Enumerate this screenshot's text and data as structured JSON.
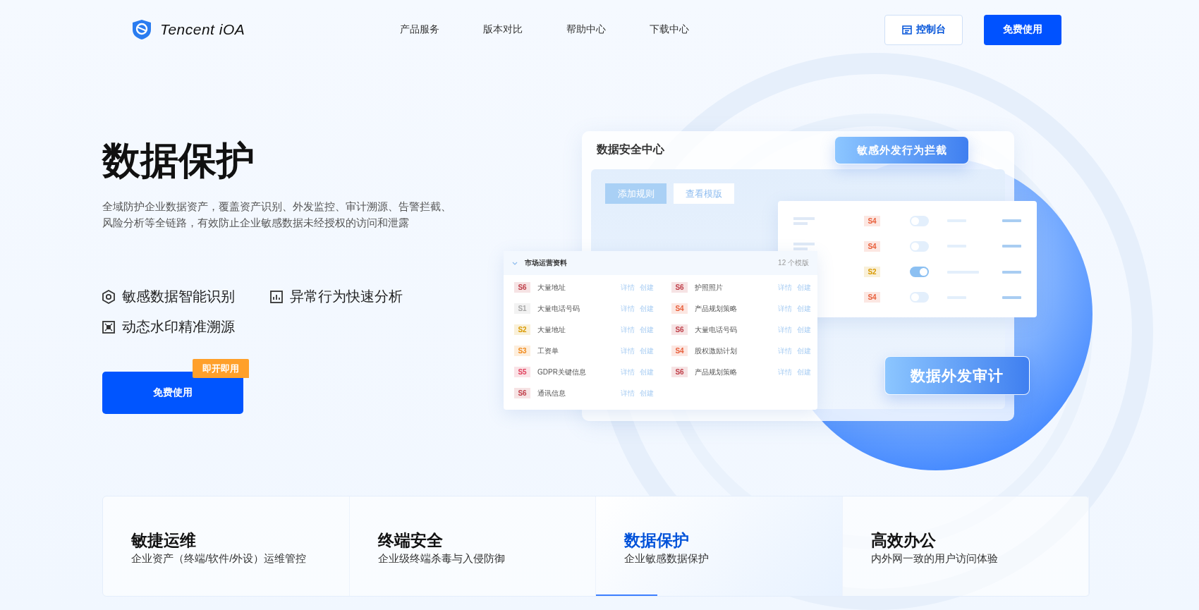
{
  "header": {
    "logo": "Tencent iOA",
    "nav": [
      "产品服务",
      "版本对比",
      "帮助中心",
      "下载中心"
    ],
    "console_button": "控制台",
    "free_button": "免费使用"
  },
  "hero": {
    "title": "数据保护",
    "description": "全域防护企业数据资产，覆盖资产识别、外发监控、审计溯源、告警拦截、风险分析等全链路，有效防止企业敏感数据未经授权的访问和泄露",
    "features": [
      {
        "kind": "hexagon",
        "text": "敏感数据智能识别"
      },
      {
        "kind": "chart",
        "text": "异常行为快速分析"
      },
      {
        "kind": "frame",
        "text": "动态水印精准溯源"
      }
    ],
    "cta": {
      "label": "免费使用",
      "badge": "即开即用"
    }
  },
  "illustration": {
    "panel_title": "数据安全中心",
    "top_bubble": "敏感外发行为拦截",
    "bottom_bubble": "数据外发审计",
    "buttons": [
      {
        "label": "添加规则",
        "selected": true
      },
      {
        "label": "查看模版",
        "selected": false
      }
    ],
    "table": {
      "title": "市场运营资料",
      "count": "12 个模版",
      "rows": [
        {
          "level": "S6",
          "color": "#c0404a",
          "name": "大量地址",
          "actions": [
            "详情",
            "创建"
          ]
        },
        {
          "level": "S6",
          "color": "#c0404a",
          "name": "护照照片",
          "actions": [
            "详情",
            "创建"
          ]
        },
        {
          "level": "S1",
          "color": "#a8a8a8",
          "name": "大量电话号码",
          "actions": [
            "详情",
            "创建"
          ]
        },
        {
          "level": "S4",
          "color": "#e8603c",
          "name": "产品规划策略",
          "actions": [
            "详情",
            "创建"
          ]
        },
        {
          "level": "S2",
          "color": "#d99a00",
          "name": "大量地址",
          "actions": [
            "详情",
            "创建"
          ]
        },
        {
          "level": "S6",
          "color": "#c0404a",
          "name": "大量电话号码",
          "actions": [
            "详情",
            "创建"
          ]
        },
        {
          "level": "S3",
          "color": "#f08a1c",
          "name": "工资单",
          "actions": [
            "详情",
            "创建"
          ]
        },
        {
          "level": "S4",
          "color": "#e8603c",
          "name": "股权激励计划",
          "actions": [
            "详情",
            "创建"
          ]
        },
        {
          "level": "S5",
          "color": "#e0405c",
          "name": "GDPR关键信息",
          "actions": [
            "详情",
            "创建"
          ]
        },
        {
          "level": "S6",
          "color": "#c0404a",
          "name": "产品规划策略",
          "actions": [
            "详情",
            "创建"
          ]
        },
        {
          "level": "S6",
          "color": "#c0404a",
          "name": "通讯信息",
          "actions": [
            "详情",
            "创建"
          ]
        }
      ]
    },
    "rules": [
      {
        "level": "S4",
        "color": "#e8603c",
        "on": false
      },
      {
        "level": "S4",
        "color": "#e8603c",
        "on": false
      },
      {
        "level": "S2",
        "color": "#d99a00",
        "on": true
      },
      {
        "level": "S4",
        "color": "#e8603c",
        "on": false
      }
    ]
  },
  "tabs": [
    {
      "title": "敏捷运维",
      "subtitle": "企业资产（终端/软件/外设）运维管控",
      "selected": false
    },
    {
      "title": "终端安全",
      "subtitle": "企业级终端杀毒与入侵防御",
      "selected": false
    },
    {
      "title": "数据保护",
      "subtitle": "企业敏感数据保护",
      "selected": true
    },
    {
      "title": "高效办公",
      "subtitle": "内外网一致的用户访问体验",
      "selected": false
    }
  ]
}
